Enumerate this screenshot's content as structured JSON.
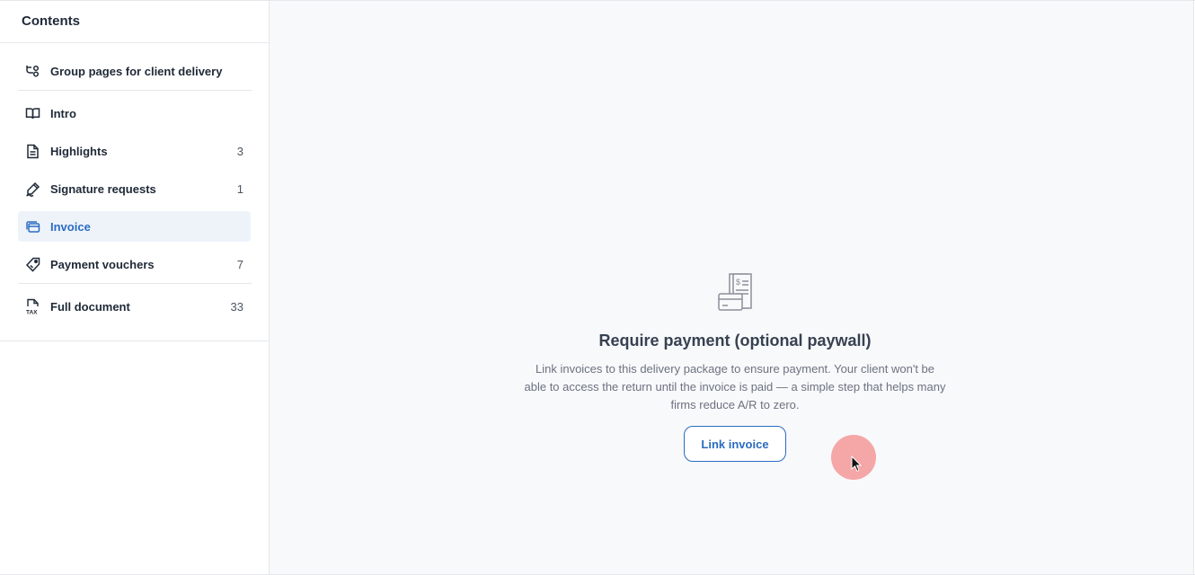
{
  "sidebar": {
    "title": "Contents",
    "items": [
      {
        "label": "Group pages for client delivery",
        "count": "",
        "icon": "group-pages-icon"
      },
      {
        "label": "Intro",
        "count": "",
        "icon": "book-icon"
      },
      {
        "label": "Highlights",
        "count": "3",
        "icon": "document-icon"
      },
      {
        "label": "Signature requests",
        "count": "1",
        "icon": "signature-pen-icon"
      },
      {
        "label": "Invoice",
        "count": "",
        "icon": "invoice-cards-icon",
        "active": true
      },
      {
        "label": "Payment vouchers",
        "count": "7",
        "icon": "voucher-tag-icon"
      },
      {
        "label": "Full document",
        "count": "33",
        "icon": "tax-document-icon"
      }
    ]
  },
  "main": {
    "empty_state": {
      "icon": "invoice-receipt-icon",
      "title": "Require payment (optional paywall)",
      "description": "Link invoices to this delivery package to ensure payment. Your client won't be able to access the return until the invoice is paid — a simple step that helps many firms reduce A/R to zero.",
      "button_label": "Link invoice"
    }
  },
  "colors": {
    "accent": "#2a6cc1",
    "active_bg": "#eef3fa",
    "main_bg": "#f8f9fb",
    "cursor_highlight": "#f48a8a"
  }
}
